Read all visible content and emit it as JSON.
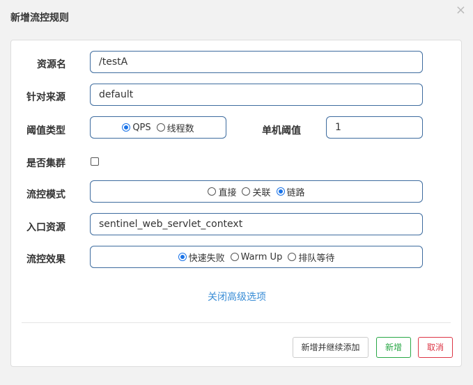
{
  "dialog": {
    "title": "新增流控规则",
    "close_glyph": "×"
  },
  "form": {
    "resource_name": {
      "label": "资源名",
      "value": "/testA"
    },
    "limit_app": {
      "label": "针对来源",
      "value": "default"
    },
    "grade": {
      "label": "阈值类型",
      "options": [
        "QPS",
        "线程数"
      ],
      "selected": "QPS"
    },
    "single_threshold": {
      "label": "单机阈值",
      "value": "1"
    },
    "cluster": {
      "label": "是否集群",
      "checked": false
    },
    "strategy": {
      "label": "流控模式",
      "options": [
        "直接",
        "关联",
        "链路"
      ],
      "selected": "链路"
    },
    "ref_resource": {
      "label": "入口资源",
      "value": "sentinel_web_servlet_context"
    },
    "control_behavior": {
      "label": "流控效果",
      "options": [
        "快速失败",
        "Warm Up",
        "排队等待"
      ],
      "selected": "快速失败"
    }
  },
  "advanced_toggle": "关闭高级选项",
  "buttons": {
    "add_and_continue": "新增并继续添加",
    "add": "新增",
    "cancel": "取消"
  },
  "colors": {
    "primary": "#1a73e8",
    "link": "#3a8dd6",
    "success": "#28a745",
    "danger": "#dc3545",
    "input_border": "#3d6b9e"
  }
}
